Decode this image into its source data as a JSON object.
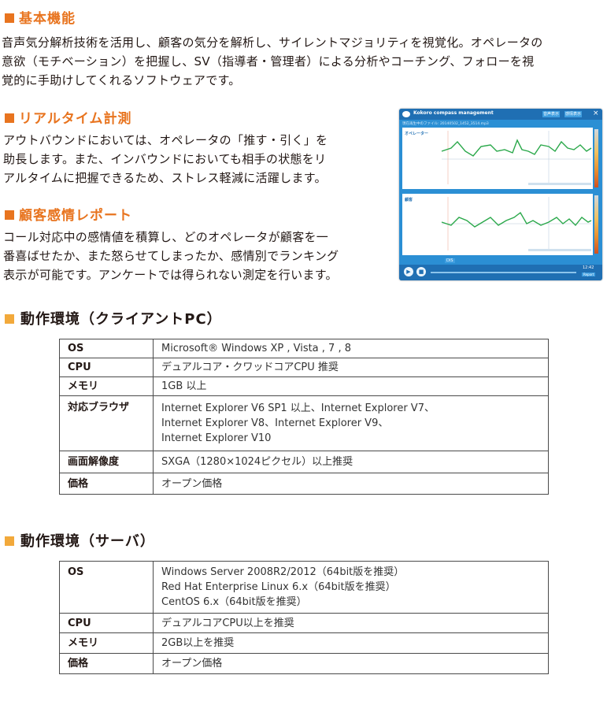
{
  "section1": {
    "heading": "基本機能",
    "lines": [
      "音声気分解析技術を活用し、顧客の気分を解析し、サイレントマジョリティを視覚化。オペレータの",
      "意欲（モチベーション）を把握し、SV（指導者・管理者）による分析やコーチング、フォローを視",
      "覚的に手助けしてくれるソフトウェアです。"
    ]
  },
  "section2": {
    "heading": "リアルタイム計測",
    "lines": [
      "アウトバウンドにおいては、オペレータの「推す・引く」を",
      "助長します。また、インバウンドにおいても相手の状態をリ",
      "アルタイムに把握できるため、ストレス軽減に活躍します。"
    ]
  },
  "section3": {
    "heading": "顧客感情レポート",
    "lines": [
      "コール対応中の感情値を積算し、どのオペレータが顧客を一",
      "番喜ばせたか、また怒らせてしまったか、感情別でランキング",
      "表示が可能です。アンケートでは得られない測定を行います。"
    ]
  },
  "screenshot": {
    "title": "Kokoro compass management",
    "tab1": "音声表示",
    "tab2": "感情表示",
    "close": "×",
    "subline": "現在再生中のファイル: 20140502_1452_3514.mp3",
    "panel1_label": "オペレーター",
    "panel2_label": "顧客",
    "dis_label": "DIS",
    "time": "12:42",
    "report_btn": "Report"
  },
  "client_env": {
    "heading": "動作環境（クライアントPC）",
    "rows": [
      {
        "key": "OS",
        "value": [
          "Microsoft® Windows XP , Vista , 7 , 8"
        ]
      },
      {
        "key": "CPU",
        "value": [
          "デュアルコア・クワッドコアCPU 推奨"
        ]
      },
      {
        "key": "メモリ",
        "value": [
          "1GB 以上"
        ]
      },
      {
        "key": "対応ブラウザ",
        "value": [
          "Internet Explorer V6 SP1 以上、Internet Explorer V7、",
          "Internet Explorer V8、Internet Explorer V9、",
          "Internet Explorer V10"
        ]
      },
      {
        "key": "画面解像度",
        "value": [
          "SXGA（1280×1024ピクセル）以上推奨"
        ]
      },
      {
        "key": "価格",
        "value": [
          "オープン価格"
        ]
      }
    ]
  },
  "server_env": {
    "heading": "動作環境（サーバ）",
    "rows": [
      {
        "key": "OS",
        "value": [
          "Windows Server 2008R2/2012（64bit版を推奨）",
          "Red Hat Enterprise Linux 6.x（64bit版を推奨）",
          "CentOS 6.x（64bit版を推奨）"
        ]
      },
      {
        "key": "CPU",
        "value": [
          "デュアルコアCPU以上を推奨"
        ]
      },
      {
        "key": "メモリ",
        "value": [
          "2GB以上を推奨"
        ]
      },
      {
        "key": "価格",
        "value": [
          "オープン価格"
        ]
      }
    ]
  },
  "colors": {
    "heading_orange": "#e8741f",
    "bullet_yellow": "#f2a93b",
    "app_blue": "#2b8fd4",
    "graph_green": "#2aa84a"
  }
}
